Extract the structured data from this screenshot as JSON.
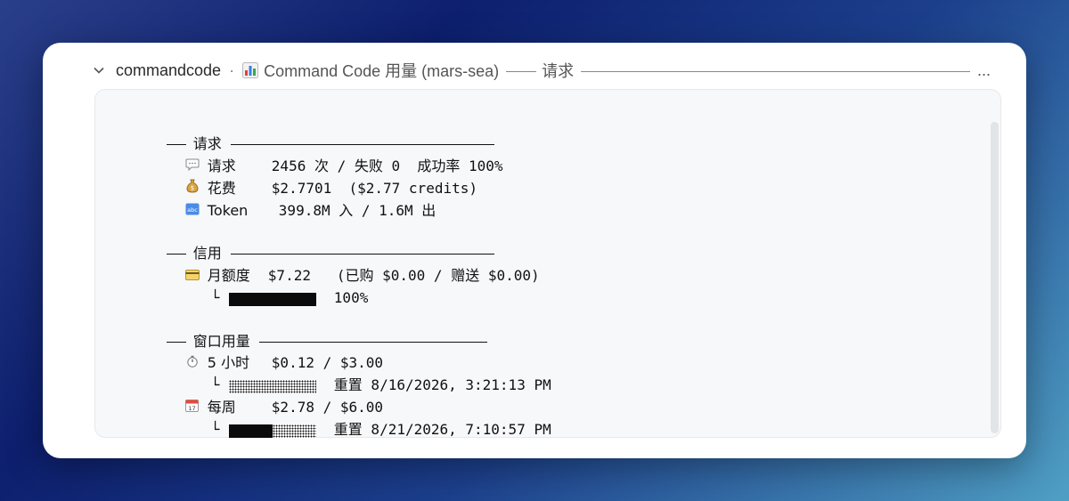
{
  "header": {
    "app": "commandcode",
    "separator": "·",
    "title": "Command Code 用量 (mars-sea)",
    "section": "请求",
    "ellipsis": "..."
  },
  "requests": {
    "title": "请求",
    "requests_label": "请求",
    "requests_value": "2456 次 / 失败 0  成功率 100%",
    "cost_label": "花费",
    "cost_value": "$2.7701  ($2.77 credits)",
    "token_label": "Token",
    "token_value": "399.8M 入 / 1.6M 出"
  },
  "credit": {
    "title": "信用",
    "monthly_label": "月额度",
    "monthly_value": "$7.22   (已购 $0.00 / 赠送 $0.00)",
    "corner": "└",
    "bar_fill": 1.0,
    "bar_text": "100%"
  },
  "window": {
    "title": "窗口用量",
    "five_hour_label": "5 小时",
    "five_hour_value": "$0.12 / $3.00",
    "five_hour_bar_fill": 0.0,
    "five_hour_reset": "重置 8/16/2026, 3:21:13 PM",
    "weekly_label": "每周",
    "weekly_value": "$2.78 / $6.00",
    "weekly_bar_fill": 0.5,
    "weekly_reset": "重置 8/21/2026, 7:10:57 PM",
    "corner": "└"
  },
  "icons": {
    "chevron": "chevron-down-icon",
    "chart": "bar-chart-icon",
    "speech": "speech-bubble-icon",
    "money": "money-bag-icon",
    "abc": "abc-icon",
    "card": "credit-card-icon",
    "stopwatch": "stopwatch-icon",
    "calendar": "calendar-icon"
  }
}
